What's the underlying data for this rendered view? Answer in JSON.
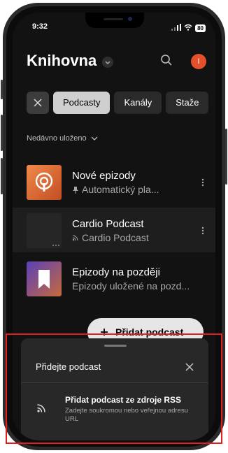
{
  "status_bar": {
    "time": "9:32",
    "battery": "80"
  },
  "header": {
    "title": "Knihovna",
    "avatar_initial": "I"
  },
  "filters": {
    "chips": [
      "Podcasty",
      "Kanály",
      "Staže"
    ]
  },
  "sort": {
    "label": "Nedávno uloženo"
  },
  "library": {
    "items": [
      {
        "title": "Nové epizody",
        "subtitle": "Automatický pla...",
        "icon": "pin-icon"
      },
      {
        "title": "Cardio Podcast",
        "subtitle": "Cardio Podcast",
        "icon": "rss-icon"
      },
      {
        "title": "Epizody na později",
        "subtitle": "Epizody uložené na pozd..."
      }
    ]
  },
  "fab": {
    "label": "Přidat podcast"
  },
  "sheet": {
    "title": "Přidejte podcast",
    "option": {
      "title": "Přidat podcast ze zdroje RSS",
      "description": "Zadejte soukromou nebo veřejnou adresu URL"
    }
  },
  "colors": {
    "accent": "#e4502b",
    "highlight": "#e21f1f"
  }
}
